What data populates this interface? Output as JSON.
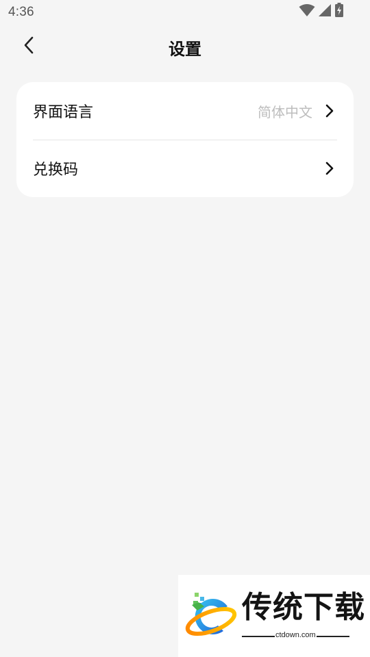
{
  "status_bar": {
    "time": "4:36",
    "icons": [
      "wifi-icon",
      "signal-icon",
      "battery-charging-icon"
    ]
  },
  "header": {
    "title": "设置",
    "back_icon": "chevron-left-icon"
  },
  "settings": {
    "items": [
      {
        "label": "界面语言",
        "value": "简体中文",
        "icon": "chevron-right-icon"
      },
      {
        "label": "兑换码",
        "icon": "chevron-right-icon"
      }
    ]
  },
  "watermark": {
    "title": "传统下载",
    "url": "ctdown.com"
  }
}
